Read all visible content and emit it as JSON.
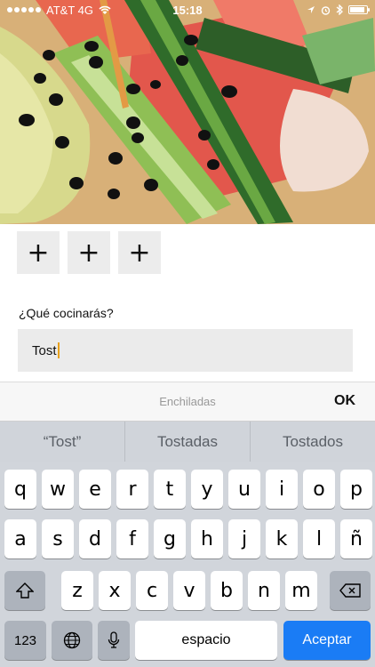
{
  "status_bar": {
    "carrier": "AT&T 4G",
    "time": "15:18",
    "battery_level": 0.9,
    "icons": [
      "wifi-icon",
      "location-icon",
      "alarm-icon",
      "bluetooth-icon",
      "battery-icon"
    ]
  },
  "hero": {
    "description_icon": "food-photo"
  },
  "add_buttons": [
    {
      "label": "+"
    },
    {
      "label": "+"
    },
    {
      "label": "+"
    }
  ],
  "form": {
    "prompt": "¿Qué cocinarás?",
    "input_value": "Tost"
  },
  "accessory": {
    "suggestion": "Enchiladas",
    "ok_label": "OK"
  },
  "keyboard": {
    "predictions": [
      "“Tost”",
      "Tostadas",
      "Tostados"
    ],
    "row1": [
      "q",
      "w",
      "e",
      "r",
      "t",
      "y",
      "u",
      "i",
      "o",
      "p"
    ],
    "row2": [
      "a",
      "s",
      "d",
      "f",
      "g",
      "h",
      "j",
      "k",
      "l",
      "ñ"
    ],
    "row3": [
      "z",
      "x",
      "c",
      "v",
      "b",
      "n",
      "m"
    ],
    "numbers_label": "123",
    "space_label": "espacio",
    "enter_label": "Aceptar",
    "accent_color": "#1a7cf5"
  }
}
